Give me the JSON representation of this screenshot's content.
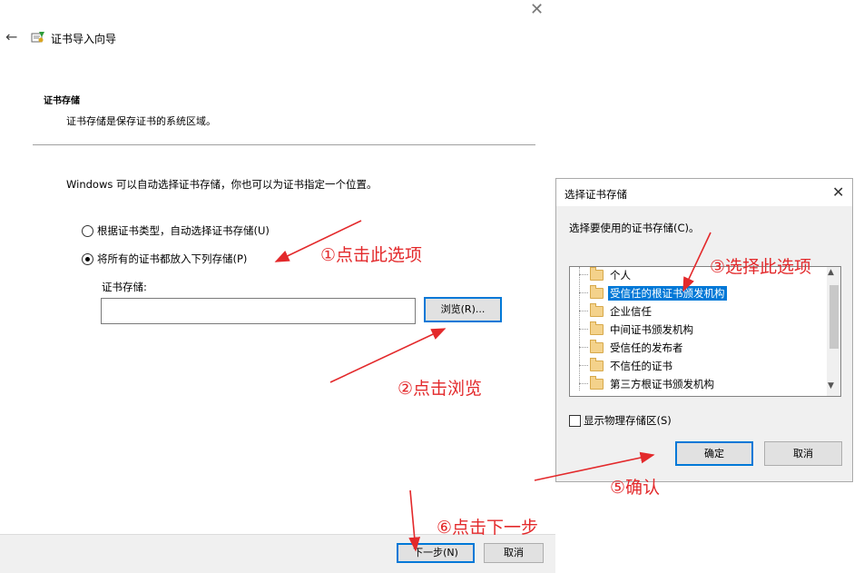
{
  "wizard": {
    "title": "证书导入向导",
    "section_title": "证书存储",
    "section_subtitle": "证书存储是保存证书的系统区域。",
    "description": "Windows 可以自动选择证书存储，你也可以为证书指定一个位置。",
    "radio_auto_label": "根据证书类型，自动选择证书存储(U)",
    "radio_manual_label": "将所有的证书都放入下列存储(P)",
    "store_label": "证书存储:",
    "store_value": "",
    "browse_label": "浏览(R)...",
    "next_label": "下一步(N)",
    "cancel_label": "取消"
  },
  "dialog": {
    "title": "选择证书存储",
    "prompt": "选择要使用的证书存储(C)。",
    "items": [
      "个人",
      "受信任的根证书颁发机构",
      "企业信任",
      "中间证书颁发机构",
      "受信任的发布者",
      "不信任的证书",
      "第三方根证书颁发机构"
    ],
    "selected_index": 1,
    "show_physical_label": "显示物理存储区(S)",
    "ok_label": "确定",
    "cancel_label": "取消"
  },
  "annotations": {
    "step1": "①点击此选项",
    "step2": "②点击浏览",
    "step3": "③选择此选项",
    "step5": "⑤确认",
    "step6": "⑥点击下一步"
  },
  "colors": {
    "annotation": "#e3292b",
    "selection": "#0078d7"
  }
}
